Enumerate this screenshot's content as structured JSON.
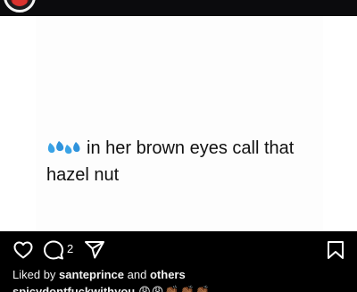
{
  "post": {
    "text": "in her brown eyes call that hazel nut",
    "droplets_icon": "sweat-droplets-icon"
  },
  "actions": {
    "like_icon": "heart-icon",
    "comment_icon": "comment-icon",
    "comment_count": "2",
    "share_icon": "paper-plane-icon",
    "save_icon": "bookmark-icon"
  },
  "likes": {
    "prefix": "Liked by",
    "user": "santeprince",
    "joiner": "and",
    "others": "others"
  },
  "caption": {
    "username": "spicydontfuckwithyou",
    "emojis": "😩😩👏🏾👏🏾👏🏾"
  },
  "colors": {
    "background": "#000000",
    "post_background": "#ffffff",
    "text": "#ffffff"
  }
}
